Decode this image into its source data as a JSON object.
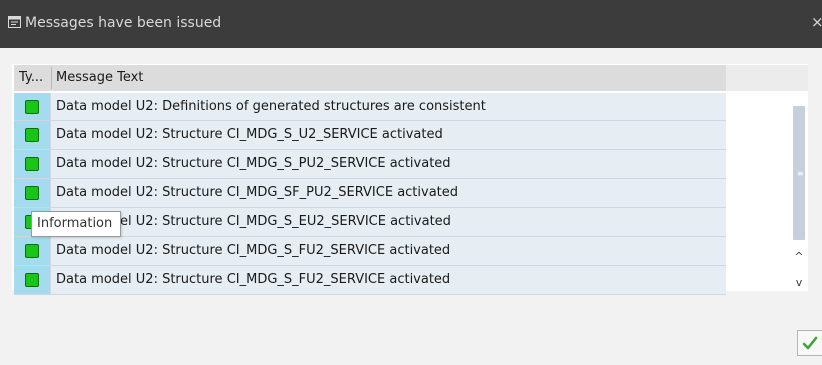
{
  "dialog": {
    "title": "Messages have been issued",
    "close_glyph": "×",
    "icon": "message-dialog-icon"
  },
  "table": {
    "columns": {
      "type": "Ty...",
      "text": "Message Text"
    },
    "rows": [
      {
        "type": "information",
        "status_color": "#19c519",
        "text": "Data model U2: Definitions of generated structures are consistent"
      },
      {
        "type": "information",
        "status_color": "#19c519",
        "text": "Data model U2: Structure CI_MDG_S_U2_SERVICE activated"
      },
      {
        "type": "information",
        "status_color": "#19c519",
        "text": "Data model U2: Structure CI_MDG_S_PU2_SERVICE activated"
      },
      {
        "type": "information",
        "status_color": "#19c519",
        "text": "Data model U2: Structure CI_MDG_SF_PU2_SERVICE activated"
      },
      {
        "type": "information",
        "status_color": "#19c519",
        "text": "Data model U2: Structure CI_MDG_S_EU2_SERVICE activated"
      },
      {
        "type": "information",
        "status_color": "#19c519",
        "text": "Data model U2: Structure CI_MDG_S_FU2_SERVICE activated"
      },
      {
        "type": "information",
        "status_color": "#19c519",
        "text": "Data model U2: Structure CI_MDG_S_FU2_SERVICE activated"
      }
    ]
  },
  "tooltip": {
    "text": "Information"
  },
  "scrollbar": {
    "up_glyph": "^",
    "down_glyph": "v",
    "grip_glyph": "≡"
  },
  "footer": {
    "ok_icon": "checkmark-icon",
    "ok_color": "#3aa53a"
  },
  "colors": {
    "titlebar": "#3c3c3c",
    "type_column": "#a4dbef",
    "row_background": "#e6edf3",
    "header_background": "#dcdcdc"
  }
}
